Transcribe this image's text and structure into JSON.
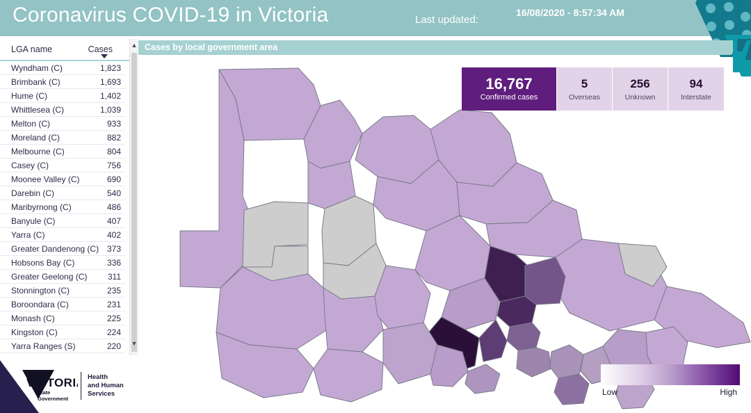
{
  "header": {
    "title": "Coronavirus COVID-19 in Victoria",
    "last_updated_label": "Last updated:",
    "last_updated_value": "16/08/2020 - 8:57:34 AM",
    "band_color": "#93c3c4",
    "virus_icon": "coronavirus-icon"
  },
  "sidebar": {
    "columns": [
      "LGA name",
      "Cases"
    ],
    "sort": {
      "column": "Cases",
      "direction": "descending",
      "icon": "caret-down-icon"
    },
    "scrollbar": {
      "up_icon": "chevron-up-icon",
      "down_icon": "chevron-down-icon"
    },
    "rows": [
      {
        "name": "Wyndham (C)",
        "cases": "1,823"
      },
      {
        "name": "Brimbank (C)",
        "cases": "1,693"
      },
      {
        "name": "Hume (C)",
        "cases": "1,402"
      },
      {
        "name": "Whittlesea (C)",
        "cases": "1,039"
      },
      {
        "name": "Melton (C)",
        "cases": "933"
      },
      {
        "name": "Moreland (C)",
        "cases": "882"
      },
      {
        "name": "Melbourne (C)",
        "cases": "804"
      },
      {
        "name": "Casey (C)",
        "cases": "756"
      },
      {
        "name": "Moonee Valley (C)",
        "cases": "690"
      },
      {
        "name": "Darebin (C)",
        "cases": "540"
      },
      {
        "name": "Maribyrnong (C)",
        "cases": "486"
      },
      {
        "name": "Banyule (C)",
        "cases": "407"
      },
      {
        "name": "Yarra (C)",
        "cases": "402"
      },
      {
        "name": "Greater Dandenong (C)",
        "cases": "373"
      },
      {
        "name": "Hobsons Bay (C)",
        "cases": "336"
      },
      {
        "name": "Greater Geelong (C)",
        "cases": "311"
      },
      {
        "name": "Stonnington (C)",
        "cases": "235"
      },
      {
        "name": "Boroondara (C)",
        "cases": "231"
      },
      {
        "name": "Monash (C)",
        "cases": "225"
      },
      {
        "name": "Kingston (C)",
        "cases": "224"
      },
      {
        "name": "Yarra Ranges (S)",
        "cases": "220"
      }
    ]
  },
  "map": {
    "title": "Cases by local government area",
    "title_bar_color": "#a6d1d2",
    "no_data_color": "#cdcdcd",
    "border_color": "#7a7a8a"
  },
  "stats": [
    {
      "value": "16,767",
      "label": "Confirmed cases",
      "primary": true,
      "color": "#5f1e7d"
    },
    {
      "value": "5",
      "label": "Overseas",
      "primary": false,
      "color": "#e3d3e8"
    },
    {
      "value": "256",
      "label": "Unknown",
      "primary": false,
      "color": "#e3d3e8"
    },
    {
      "value": "94",
      "label": "Interstate",
      "primary": false,
      "color": "#e3d3e8"
    }
  ],
  "legend": {
    "low_label": "Low",
    "high_label": "High",
    "low_color": "#ffffff",
    "high_color": "#520c74"
  },
  "footer": {
    "logo_text": "VICTORIA",
    "logo_sub_line1": "State",
    "logo_sub_line2": "Government",
    "department_line1": "Health",
    "department_line2": "and Human",
    "department_line3": "Services",
    "wedge_color": "#27204f"
  },
  "chart_data": {
    "type": "bar",
    "title": "Cases by local government area",
    "xlabel": "LGA name",
    "ylabel": "Cases",
    "categories": [
      "Wyndham (C)",
      "Brimbank (C)",
      "Hume (C)",
      "Whittlesea (C)",
      "Melton (C)",
      "Moreland (C)",
      "Melbourne (C)",
      "Casey (C)",
      "Moonee Valley (C)",
      "Darebin (C)",
      "Maribyrnong (C)",
      "Banyule (C)",
      "Yarra (C)",
      "Greater Dandenong (C)",
      "Hobsons Bay (C)",
      "Greater Geelong (C)",
      "Stonnington (C)",
      "Boroondara (C)",
      "Monash (C)",
      "Kingston (C)",
      "Yarra Ranges (S)"
    ],
    "values": [
      1823,
      1693,
      1402,
      1039,
      933,
      882,
      804,
      756,
      690,
      540,
      486,
      407,
      402,
      373,
      336,
      311,
      235,
      231,
      225,
      224,
      220
    ],
    "totals": {
      "confirmed_cases": 16767,
      "overseas": 5,
      "unknown": 256,
      "interstate": 94
    },
    "ylim": [
      0,
      1823
    ],
    "grid": false,
    "legend_position": "bottom-right"
  }
}
